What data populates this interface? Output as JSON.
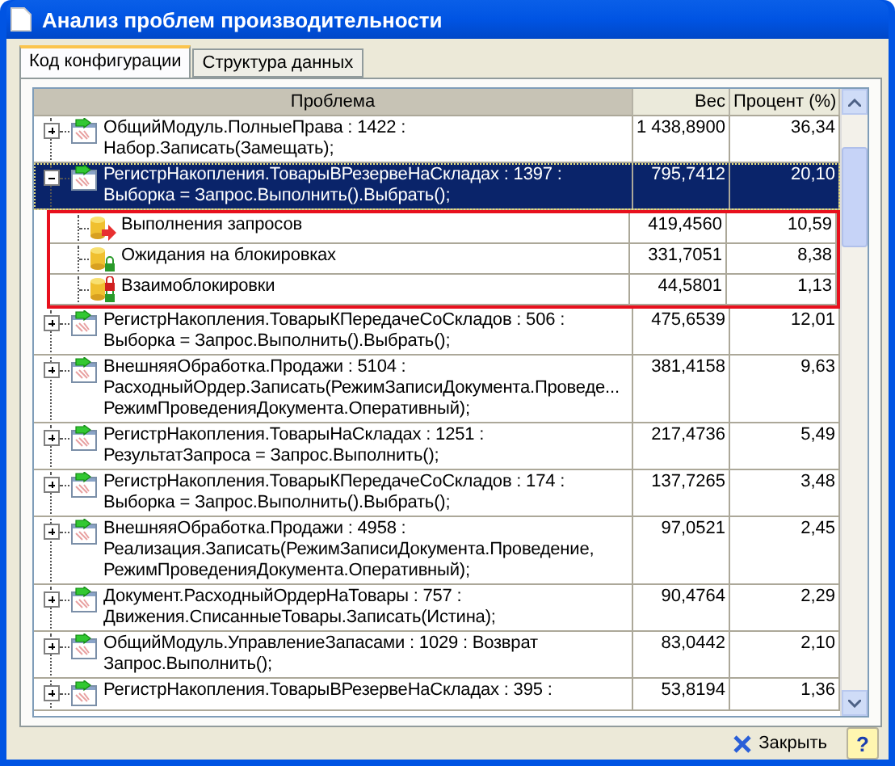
{
  "window": {
    "title": "Анализ проблем производительности"
  },
  "tabs": [
    {
      "label": "Код конфигурации",
      "selected": true
    },
    {
      "label": "Структура данных",
      "selected": false
    }
  ],
  "table": {
    "columns": [
      "Проблема",
      "Вес",
      "Процент (%)"
    ],
    "rows": [
      {
        "expanded": false,
        "selected": false,
        "lines": [
          "ОбщийМодуль.ПолныеПрава : 1422 :",
          "Набор.Записать(Замещать);"
        ],
        "weight": "1 438,8900",
        "percent": "36,34"
      },
      {
        "expanded": true,
        "selected": true,
        "lines": [
          "РегистрНакопления.ТоварыВРезервеНаСкладах : 1397 :",
          "Выборка = Запрос.Выполнить().Выбрать();"
        ],
        "weight": "795,7412",
        "percent": "20,10",
        "children": [
          {
            "kind": "query",
            "label": "Выполнения запросов",
            "weight": "419,4560",
            "percent": "10,59"
          },
          {
            "kind": "wait",
            "label": "Ожидания на блокировках",
            "weight": "331,7051",
            "percent": "8,38"
          },
          {
            "kind": "deadlock",
            "label": "Взаимоблокировки",
            "weight": "44,5801",
            "percent": "1,13"
          }
        ]
      },
      {
        "expanded": false,
        "selected": false,
        "lines": [
          "РегистрНакопления.ТоварыКПередачеСоСкладов : 506 :",
          "Выборка = Запрос.Выполнить().Выбрать();"
        ],
        "weight": "475,6539",
        "percent": "12,01"
      },
      {
        "expanded": false,
        "selected": false,
        "lines": [
          "ВнешняяОбработка.Продажи : 5104 :",
          "РасходныйОрдер.Записать(РежимЗаписиДокумента.Проведе...",
          "РежимПроведенияДокумента.Оперативный);"
        ],
        "weight": "381,4158",
        "percent": "9,63"
      },
      {
        "expanded": false,
        "selected": false,
        "lines": [
          "РегистрНакопления.ТоварыНаСкладах : 1251 :",
          "РезультатЗапроса = Запрос.Выполнить();"
        ],
        "weight": "217,4736",
        "percent": "5,49"
      },
      {
        "expanded": false,
        "selected": false,
        "lines": [
          "РегистрНакопления.ТоварыКПередачеСоСкладов : 174 :",
          "Выборка = Запрос.Выполнить().Выбрать();"
        ],
        "weight": "137,7265",
        "percent": "3,48"
      },
      {
        "expanded": false,
        "selected": false,
        "lines": [
          "ВнешняяОбработка.Продажи : 4958 :",
          "Реализация.Записать(РежимЗаписиДокумента.Проведение,",
          "РежимПроведенияДокумента.Оперативный);"
        ],
        "weight": "97,0521",
        "percent": "2,45"
      },
      {
        "expanded": false,
        "selected": false,
        "lines": [
          "Документ.РасходныйОрдерНаТовары : 757 :",
          "Движения.СписанныеТовары.Записать(Истина);"
        ],
        "weight": "90,4764",
        "percent": "2,29"
      },
      {
        "expanded": false,
        "selected": false,
        "lines": [
          "ОбщийМодуль.УправлениеЗапасами : 1029 : Возврат",
          "Запрос.Выполнить();"
        ],
        "weight": "83,0442",
        "percent": "2,10"
      },
      {
        "expanded": false,
        "selected": false,
        "lines": [
          "РегистрНакопления.ТоварыВРезервеНаСкладах : 395 :"
        ],
        "weight": "53,8194",
        "percent": "1,36"
      }
    ]
  },
  "buttons": [
    {
      "kind": "close",
      "label": "Закрыть"
    },
    {
      "kind": "help",
      "label": "?"
    }
  ]
}
